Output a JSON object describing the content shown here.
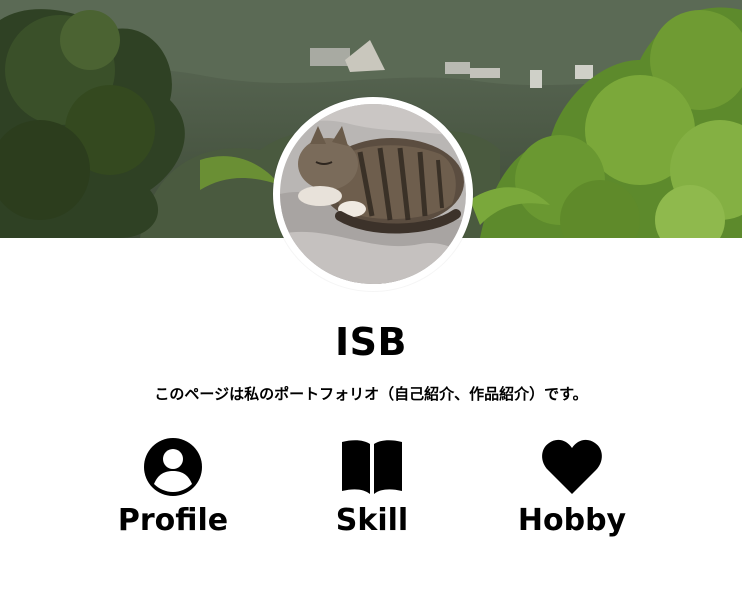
{
  "profile": {
    "title": "ISB",
    "description": "このページは私のポートフォリオ（自己紹介、作品紹介）です。"
  },
  "nav": {
    "items": [
      {
        "label": "Profile",
        "icon": "user-circle-icon"
      },
      {
        "label": "Skill",
        "icon": "open-book-icon"
      },
      {
        "label": "Hobby",
        "icon": "heart-icon"
      }
    ]
  },
  "images": {
    "header": "forest-landscape-photo",
    "avatar": "sleeping-tabby-cat-photo"
  }
}
